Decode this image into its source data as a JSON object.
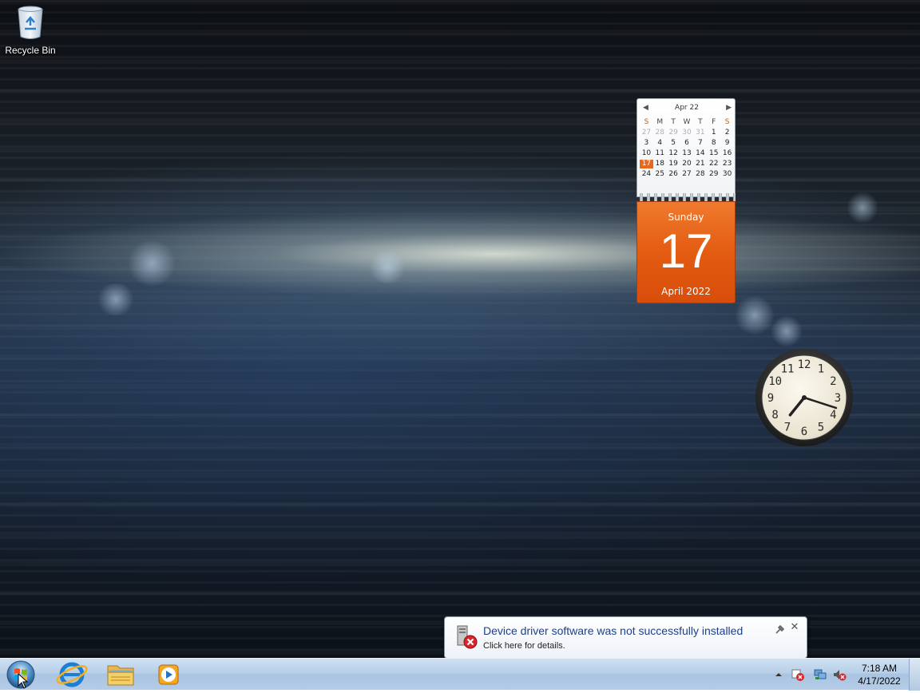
{
  "desktop": {
    "icons": [
      {
        "label": "Recycle Bin"
      }
    ]
  },
  "calendar_gadget": {
    "month_header": "Apr 22",
    "day_of_week_headers": [
      "S",
      "M",
      "T",
      "W",
      "T",
      "F",
      "S"
    ],
    "weeks": [
      [
        "27",
        "28",
        "29",
        "30",
        "31",
        "1",
        "2"
      ],
      [
        "3",
        "4",
        "5",
        "6",
        "7",
        "8",
        "9"
      ],
      [
        "10",
        "11",
        "12",
        "13",
        "14",
        "15",
        "16"
      ],
      [
        "17",
        "18",
        "19",
        "20",
        "21",
        "22",
        "23"
      ],
      [
        "24",
        "25",
        "26",
        "27",
        "28",
        "29",
        "30"
      ]
    ],
    "today": "17",
    "weekday": "Sunday",
    "day": "17",
    "month_year": "April 2022",
    "accent_color": "#e35c12"
  },
  "clock_gadget": {
    "hour": 7,
    "minute": 18,
    "numerals": [
      "12",
      "1",
      "2",
      "3",
      "4",
      "5",
      "6",
      "7",
      "8",
      "9",
      "10",
      "11"
    ]
  },
  "notification": {
    "title": "Device driver software was not successfully installed",
    "text": "Click here for details.",
    "icon": "device-error-icon",
    "close_glyph": "✕"
  },
  "taskbar": {
    "start_icon": "windows-start-orb",
    "pinned": [
      {
        "name": "internet-explorer",
        "icon": "internet-explorer-icon"
      },
      {
        "name": "windows-explorer",
        "icon": "folder-icon"
      },
      {
        "name": "windows-media-player",
        "icon": "media-player-icon"
      }
    ],
    "tray": {
      "icons": [
        "show-hidden-icons-arrow",
        "action-center-error-icon",
        "network-icon",
        "volume-muted-icon"
      ],
      "time": "7:18 AM",
      "date": "4/17/2022"
    }
  }
}
